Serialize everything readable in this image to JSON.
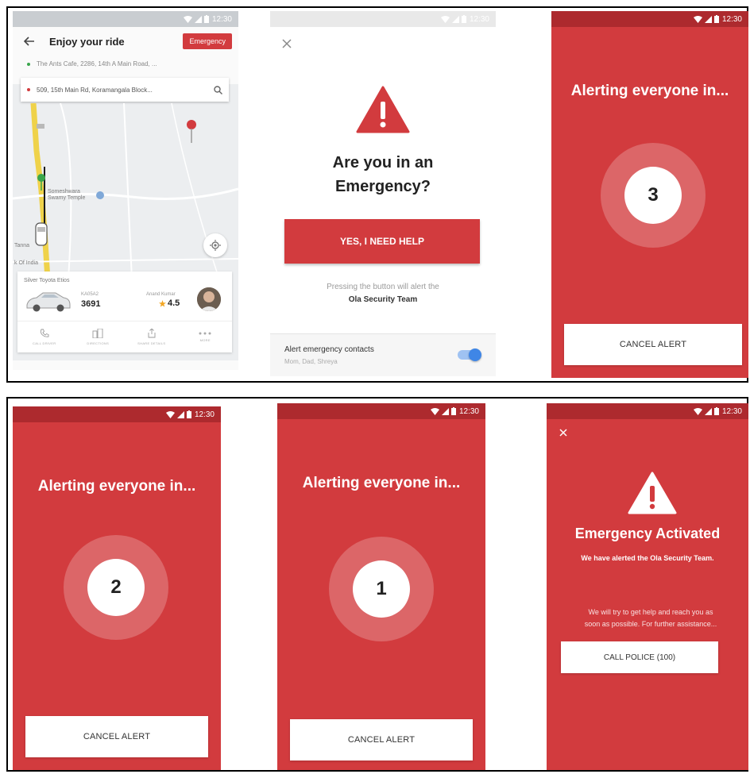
{
  "status_bar": {
    "time": "12:30"
  },
  "screen_map": {
    "title": "Enjoy your ride",
    "emergency_label": "Emergency",
    "pickup": "The Ants Cafe, 2286, 14th A Main Road, ...",
    "drop": "509, 15th Main Rd, Koramangala Block...",
    "poi_temple": "Someshwara Swamy Temple",
    "poi_left_1": "Tanna",
    "poi_left_2": "k Of India",
    "car_model": "Silver Toyota Etios",
    "plate_label": "KA05A2",
    "plate_number": "3691",
    "driver_name": "Anand Kumar",
    "rating": "4.5",
    "actions": [
      {
        "label": "CALL DRIVER",
        "icon": "phone-icon"
      },
      {
        "label": "DIRECTIONS",
        "icon": "directions-icon"
      },
      {
        "label": "SHARE DETAILS",
        "icon": "share-icon"
      },
      {
        "label": "MORE",
        "icon": "more-icon"
      }
    ],
    "colors": {
      "accent": "#d23b3e",
      "pickup_dot": "#3aa64c",
      "drop_dot": "#d23b3e"
    }
  },
  "screen_confirm": {
    "question_line1": "Are you in an",
    "question_line2": "Emergency?",
    "help_button": "YES, I NEED HELP",
    "note_line1": "Pressing the button will alert the",
    "note_line2": "Ola Security Team",
    "contacts_title": "Alert emergency contacts",
    "contacts_sub": "Mom, Dad, Shreya",
    "contacts_enabled": true
  },
  "countdown": {
    "title": "Alerting everyone in...",
    "cancel_label": "CANCEL ALERT",
    "counts": [
      "3",
      "2",
      "1"
    ]
  },
  "screen_activated": {
    "title": "Emergency Activated",
    "subtitle": "We have alerted the Ola Security Team.",
    "desc_line1": "We will try to get help and reach you as",
    "desc_line2": "soon as possible. For further assistance...",
    "police_button": "CALL POLICE (100)"
  },
  "colors": {
    "red": "#d23b3e",
    "red_dark": "#ad2a2e",
    "toggle_blue": "#3f86e6"
  }
}
